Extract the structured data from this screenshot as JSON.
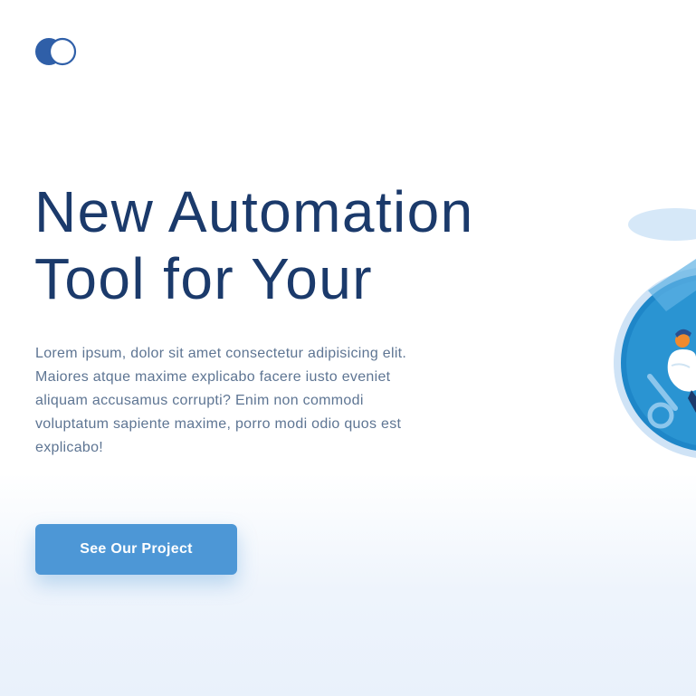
{
  "header": {
    "logo_icon": "toggle-circles-logo"
  },
  "hero": {
    "title_line1": "New Automation",
    "title_line2": "Tool for Your",
    "description": "Lorem ipsum, dolor sit amet consectetur adipisicing elit. Maiores atque maxime explicabo facere iusto eveniet aliquam accusamus corrupti? Enim non commodi voluptatum sapiente maxime, porro modi odio quos est explicabo!",
    "cta_label": "See Our Project"
  },
  "illustration": {
    "icon": "automation-person-illustration"
  },
  "colors": {
    "title": "#1b3a6b",
    "text": "#5e7593",
    "accent": "#4d97d6",
    "logo": "#2f5fa8"
  }
}
